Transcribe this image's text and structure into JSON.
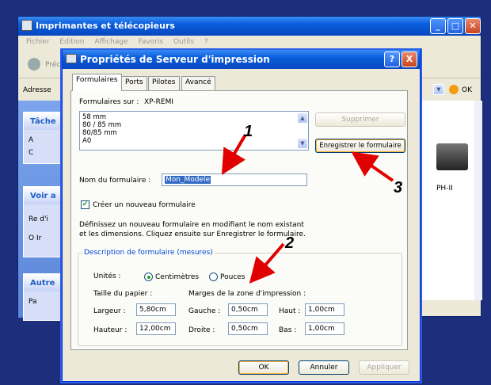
{
  "background_window": {
    "title": "Imprimantes et télécopieurs",
    "menu": [
      "Fichier",
      "Edition",
      "Affichage",
      "Favoris",
      "Outils",
      "?"
    ],
    "back_label": "Préc",
    "address_label": "Adresse",
    "ok_label": "OK",
    "panel1_head": "Tâche",
    "panel1_items": [
      "A",
      "C"
    ],
    "panel2_head": "Voir a",
    "panel2_items": [
      "Re d'i",
      "O Ir"
    ],
    "panel3_head": "Autre",
    "panel3_items": [
      "Pa"
    ],
    "printer_label": "PH-II"
  },
  "dialog": {
    "title": "Propriétés de Serveur d'impression",
    "help_btn": "?",
    "close_btn": "X",
    "tabs": [
      "Formulaires",
      "Ports",
      "Pilotes",
      "Avancé"
    ],
    "forms_on_label": "Formulaires sur :",
    "forms_on_value": "XP-REMI",
    "forms_list": [
      "58 mm",
      "80 / 85 mm",
      "80/85 mm",
      "A0"
    ],
    "delete_btn": "Supprimer",
    "save_btn": "Enregistrer le formulaire",
    "form_name_label": "Nom du formulaire :",
    "form_name_value": "Mon_Modele",
    "create_new_label": "Créer un nouveau formulaire",
    "create_new_checked": true,
    "help_text_1": "Définissez un nouveau formulaire en modifiant le nom existant",
    "help_text_2": "et les dimensions. Cliquez ensuite sur Enregistrer le formulaire.",
    "desc_group": "Description de formulaire (mesures)",
    "units_label": "Unités :",
    "units_cm": "Centimètres",
    "units_in": "Pouces",
    "units_selected": "Centimètres",
    "paper_size_label": "Taille du papier :",
    "margins_label": "Marges de la zone d'impression :",
    "width_label": "Largeur :",
    "width_value": "5,80cm",
    "height_label": "Hauteur :",
    "height_value": "12,00cm",
    "left_label": "Gauche :",
    "left_value": "0,50cm",
    "right_label": "Droite :",
    "right_value": "0,50cm",
    "top_label": "Haut :",
    "top_value": "1,00cm",
    "bottom_label": "Bas :",
    "bottom_value": "1,00cm",
    "ok_btn": "OK",
    "cancel_btn": "Annuler",
    "apply_btn": "Appliquer"
  },
  "annotations": [
    "1",
    "2",
    "3"
  ],
  "colors": {
    "arrow": "#e00000",
    "title_blue": "#0a5ddb"
  }
}
